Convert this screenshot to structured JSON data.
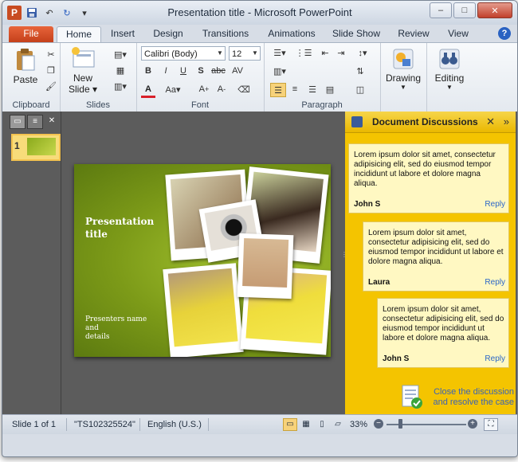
{
  "window": {
    "title": "Presentation title  -  Microsoft PowerPoint",
    "controls": {
      "minimize": "–",
      "maximize": "□",
      "close": "✕"
    }
  },
  "qat": {
    "save": "💾",
    "undo": "↶",
    "redo": "↻",
    "customize": "▾"
  },
  "tabs": [
    {
      "label": "File"
    },
    {
      "label": "Home"
    },
    {
      "label": "Insert"
    },
    {
      "label": "Design"
    },
    {
      "label": "Transitions"
    },
    {
      "label": "Animations"
    },
    {
      "label": "Slide Show"
    },
    {
      "label": "Review"
    },
    {
      "label": "View"
    }
  ],
  "help": "?",
  "ribbon": {
    "clipboard": {
      "label": "Clipboard",
      "paste": "Paste"
    },
    "slides": {
      "label": "Slides",
      "new_slide_line1": "New",
      "new_slide_line2": "Slide ▾"
    },
    "font": {
      "label": "Font",
      "font_name": "Calibri (Body)",
      "font_size": "12"
    },
    "paragraph": {
      "label": "Paragraph"
    },
    "drawing": {
      "label": "Drawing"
    },
    "editing": {
      "label": "Editing"
    }
  },
  "slides_pane": {
    "tab_slides": "▭",
    "tab_outline": "≡",
    "close": "✕",
    "thumb_number": "1"
  },
  "slide": {
    "title_line1": "Presentation",
    "title_line2": "title",
    "subtitle_line1": "Presenters name and",
    "subtitle_line2": "details"
  },
  "discussion": {
    "title": "Document Discussions",
    "close": "✕",
    "collapse": "»",
    "comments": [
      {
        "text": "Lorem ipsum dolor sit amet, consectetur adipisicing elit, sed do eiusmod tempor incididunt ut labore et dolore magna aliqua.",
        "author": "John S",
        "reply": "Reply"
      },
      {
        "text": "Lorem ipsum dolor sit amet, consectetur adipisicing elit, sed do eiusmod tempor incididunt ut labore et dolore magna aliqua.",
        "author": "Laura",
        "reply": "Reply"
      },
      {
        "text": "Lorem ipsum dolor sit amet, consectetur adipisicing elit, sed do eiusmod tempor incididunt ut labore et dolore magna aliqua.",
        "author": "John S",
        "reply": "Reply"
      }
    ],
    "resolve_line1": "Close the discussion",
    "resolve_line2": "and resolve the case"
  },
  "status": {
    "slide_count": "Slide 1 of 1",
    "theme": "\"TS102325524\"",
    "language": "English (U.S.)",
    "zoom": "33%"
  }
}
